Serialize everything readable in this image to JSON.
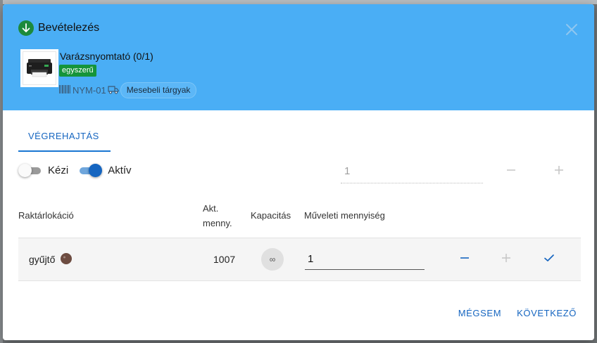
{
  "dialog": {
    "title": "Bevételezés",
    "product": {
      "name": "Varázsnyomtató (0/1)",
      "type_badge": "egyszerű",
      "sku": "NYM-01",
      "category": "Mesebeli tárgyak"
    }
  },
  "tabs": [
    {
      "label": "Végrehajtás",
      "active": true
    }
  ],
  "toggles": [
    {
      "label": "Kézi",
      "on": false
    },
    {
      "label": "Aktív",
      "on": true
    }
  ],
  "bulk_quantity": {
    "value": "1"
  },
  "table": {
    "headers": {
      "location": "Raktárlokáció",
      "current_qty_line1": "Akt.",
      "current_qty_line2": "menny.",
      "capacity": "Kapacitás",
      "operation_qty": "Műveleti mennyiség"
    },
    "rows": [
      {
        "location": "gyűjtő",
        "current_qty": "1007",
        "capacity": "∞",
        "operation_qty": "1"
      }
    ]
  },
  "actions": {
    "cancel_label": "Mégsem",
    "next_label": "Következő"
  },
  "colors": {
    "header_bg": "#4aaef5",
    "accent": "#1565c0",
    "badge_green": "#15943a"
  }
}
